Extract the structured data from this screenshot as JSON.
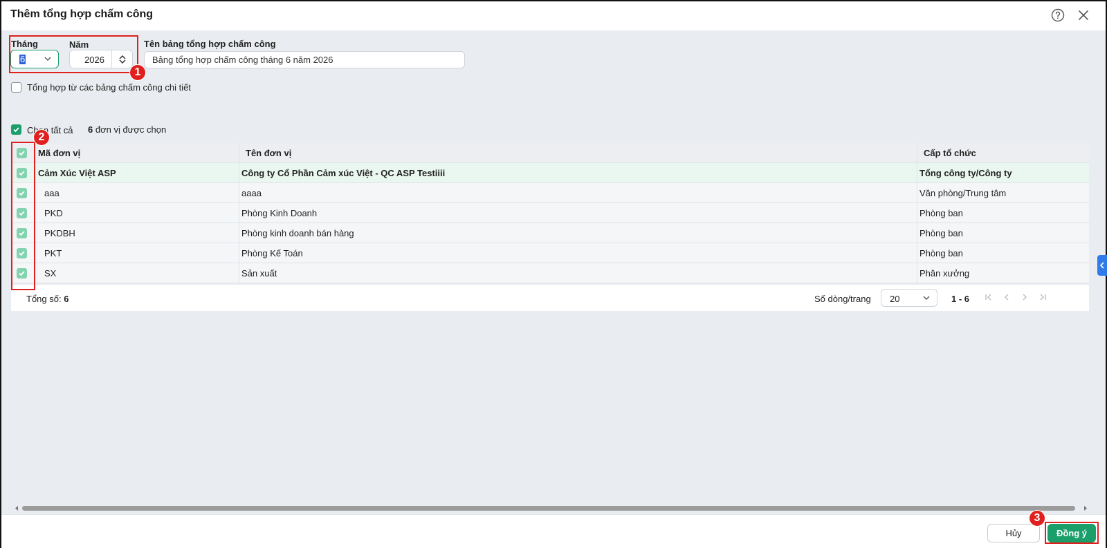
{
  "dialog": {
    "title": "Thêm tổng hợp chấm công",
    "help_icon": "help-circle-icon",
    "close_icon": "close-icon"
  },
  "form": {
    "month_label": "Tháng",
    "month_value": "6",
    "year_label": "Năm",
    "year_value": "2026",
    "name_label": "Tên bảng tổng hợp chấm công",
    "name_value": "Bảng tổng hợp chấm công tháng 6 năm 2026",
    "detail_checkbox_label": "Tổng hợp từ các bảng chấm công chi tiết"
  },
  "selection": {
    "select_all_label": "Chọn tất cả",
    "count": "6",
    "count_suffix": "đơn vị được chọn"
  },
  "table": {
    "columns": [
      "Mã đơn vị",
      "Tên đơn vị",
      "Cấp tổ chức"
    ],
    "rows": [
      {
        "code": "Cảm Xúc Việt ASP",
        "name": "Công ty Cổ Phần Cảm xúc Việt - QC ASP Testiiii",
        "level": "Tổng công ty/Công ty"
      },
      {
        "code": "aaa",
        "name": "aaaa",
        "level": "Văn phòng/Trung tâm"
      },
      {
        "code": "PKD",
        "name": "Phòng Kinh Doanh",
        "level": "Phòng ban"
      },
      {
        "code": "PKDBH",
        "name": "Phòng kinh doanh bán hàng",
        "level": "Phòng ban"
      },
      {
        "code": "PKT",
        "name": "Phòng Kế Toán",
        "level": "Phòng ban"
      },
      {
        "code": "SX",
        "name": "Sản xuất",
        "level": "Phân xưởng"
      }
    ]
  },
  "pagination": {
    "total_label": "Tổng số:",
    "total_value": "6",
    "rows_per_page_label": "Số dòng/trang",
    "rows_per_page_value": "20",
    "range": "1 - 6"
  },
  "annotations": [
    "1",
    "2",
    "3"
  ],
  "actions": {
    "cancel_label": "Hủy",
    "ok_label": "Đồng ý"
  },
  "colors": {
    "accent": "#1a9e6a",
    "annotation_red": "#e0201f",
    "side_tab": "#2f7bea"
  }
}
